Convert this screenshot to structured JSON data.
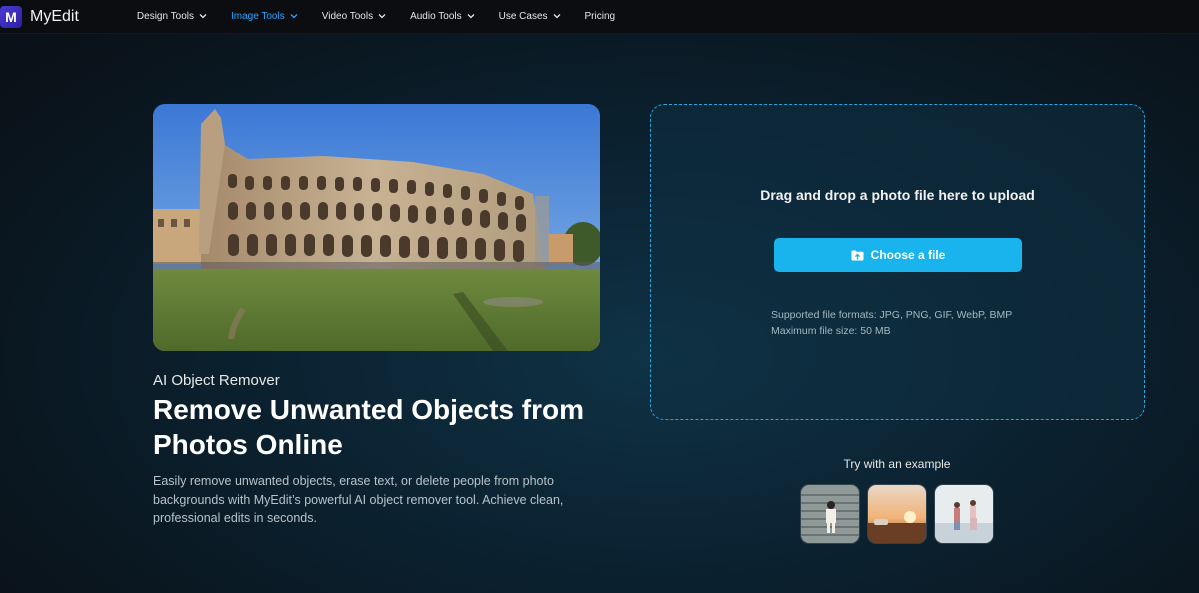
{
  "brand": {
    "logo_letter": "M",
    "name": "MyEdit"
  },
  "nav": {
    "items": [
      {
        "label": "Design Tools",
        "dropdown": true
      },
      {
        "label": "Image Tools",
        "dropdown": true,
        "active": true
      },
      {
        "label": "Video Tools",
        "dropdown": true
      },
      {
        "label": "Audio Tools",
        "dropdown": true
      },
      {
        "label": "Use Cases",
        "dropdown": true
      },
      {
        "label": "Pricing",
        "dropdown": false
      }
    ]
  },
  "hero": {
    "subtitle": "AI Object Remover",
    "title": "Remove Unwanted Objects from Photos Online",
    "description": "Easily remove unwanted objects, erase text, or delete people from photo backgrounds with MyEdit’s powerful AI object remover tool. Achieve clean, professional edits in seconds."
  },
  "upload": {
    "drag_text": "Drag and drop a photo file here to upload",
    "button_label": "Choose a file",
    "formats": "Supported file formats: JPG, PNG, GIF, WebP, BMP",
    "max_size": "Maximum file size: 50 MB"
  },
  "examples": {
    "label": "Try with an example"
  },
  "colors": {
    "accent": "#19b4ee",
    "nav_active": "#2aa6ff",
    "dropzone_border": "#2aa6e0",
    "brand": "#4b3bd6"
  }
}
